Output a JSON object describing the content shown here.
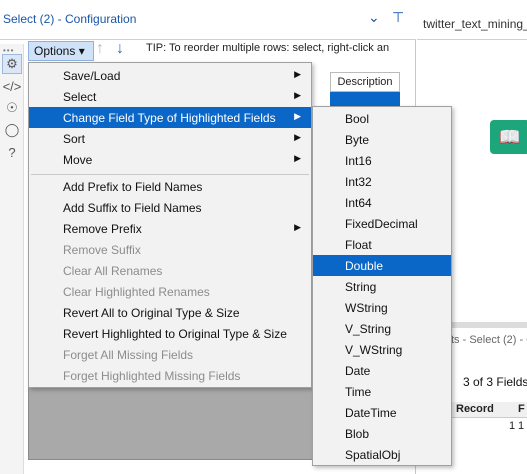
{
  "config": {
    "title": "Select (2) - Configuration",
    "chevron_icon": "chevron-down-icon",
    "pin_icon": "pin-icon"
  },
  "toolbar": {
    "options_label": "Options ▾",
    "tip": "TIP: To reorder multiple rows: select, right-click an"
  },
  "grid": {
    "description_header": "Description"
  },
  "tool_strip": [
    "gear-icon",
    "code-icon",
    "tag-annotation-icon",
    "tag-icon",
    "help-icon"
  ],
  "canvas": {
    "tab_title": "twitter_text_mining_"
  },
  "results": {
    "title": "ts - Select (2) - C",
    "fields_count": "3 of 3 Fields",
    "col_record": "Record",
    "col_f": "F",
    "row_num": "1",
    "row_val": "1"
  },
  "menu": {
    "items": [
      {
        "label": "Save/Load",
        "submenu": true,
        "disabled": false,
        "highlighted": false
      },
      {
        "label": "Select",
        "submenu": true,
        "disabled": false,
        "highlighted": false
      },
      {
        "label": "Change Field Type of Highlighted Fields",
        "submenu": true,
        "disabled": false,
        "highlighted": true
      },
      {
        "label": "Sort",
        "submenu": true,
        "disabled": false,
        "highlighted": false
      },
      {
        "label": "Move",
        "submenu": true,
        "disabled": false,
        "highlighted": false
      },
      {
        "label": "Add Prefix to Field Names",
        "submenu": false,
        "disabled": false,
        "highlighted": false
      },
      {
        "label": "Add Suffix to Field Names",
        "submenu": false,
        "disabled": false,
        "highlighted": false
      },
      {
        "label": "Remove Prefix",
        "submenu": true,
        "disabled": false,
        "highlighted": false
      },
      {
        "label": "Remove Suffix",
        "submenu": false,
        "disabled": true,
        "highlighted": false
      },
      {
        "label": "Clear All Renames",
        "submenu": false,
        "disabled": true,
        "highlighted": false
      },
      {
        "label": "Clear Highlighted Renames",
        "submenu": false,
        "disabled": true,
        "highlighted": false
      },
      {
        "label": "Revert All to Original Type & Size",
        "submenu": false,
        "disabled": false,
        "highlighted": false
      },
      {
        "label": "Revert Highlighted to Original Type & Size",
        "submenu": false,
        "disabled": false,
        "highlighted": false
      },
      {
        "label": "Forget All Missing Fields",
        "submenu": false,
        "disabled": true,
        "highlighted": false
      },
      {
        "label": "Forget Highlighted Missing Fields",
        "submenu": false,
        "disabled": true,
        "highlighted": false
      }
    ]
  },
  "submenu": {
    "items": [
      {
        "label": "Bool",
        "highlighted": false
      },
      {
        "label": "Byte",
        "highlighted": false
      },
      {
        "label": "Int16",
        "highlighted": false
      },
      {
        "label": "Int32",
        "highlighted": false
      },
      {
        "label": "Int64",
        "highlighted": false
      },
      {
        "label": "FixedDecimal",
        "highlighted": false
      },
      {
        "label": "Float",
        "highlighted": false
      },
      {
        "label": "Double",
        "highlighted": true
      },
      {
        "label": "String",
        "highlighted": false
      },
      {
        "label": "WString",
        "highlighted": false
      },
      {
        "label": "V_String",
        "highlighted": false
      },
      {
        "label": "V_WString",
        "highlighted": false
      },
      {
        "label": "Date",
        "highlighted": false
      },
      {
        "label": "Time",
        "highlighted": false
      },
      {
        "label": "DateTime",
        "highlighted": false
      },
      {
        "label": "Blob",
        "highlighted": false
      },
      {
        "label": "SpatialObj",
        "highlighted": false
      }
    ]
  },
  "colors": {
    "accent": "#0a67c7",
    "title_blue": "#1a56a8",
    "menu_bg": "#f2f2f2",
    "grid_gray": "#a9a9a9"
  }
}
